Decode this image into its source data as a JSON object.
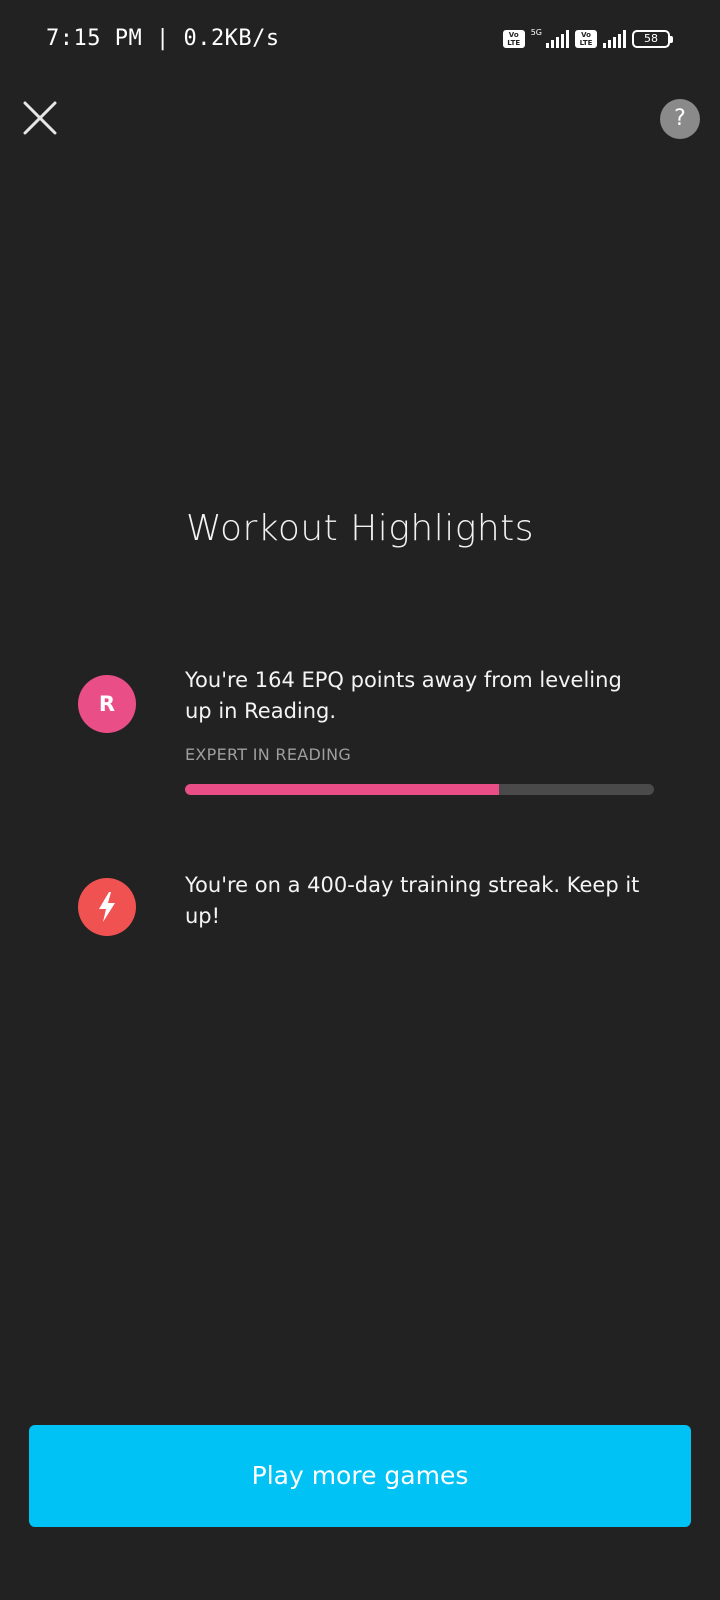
{
  "status_bar": {
    "time": "7:15 PM | 0.2KB/s",
    "volte_label": "Vo LTE",
    "network_tag": "5G",
    "battery": "58"
  },
  "header": {
    "help_label": "?"
  },
  "title": "Workout Highlights",
  "highlights": [
    {
      "icon_letter": "R",
      "icon_color": "#ea4e86",
      "text": "You're 164 EPQ points away from leveling up in Reading.",
      "caption": "EXPERT IN READING",
      "progress": 0.67
    },
    {
      "icon_name": "lightning-bolt-icon",
      "icon_color": "#f05252",
      "text": "You're on a 400-day training streak. Keep it up!"
    }
  ],
  "cta": {
    "label": "Play more games",
    "color": "#00c2f5"
  }
}
